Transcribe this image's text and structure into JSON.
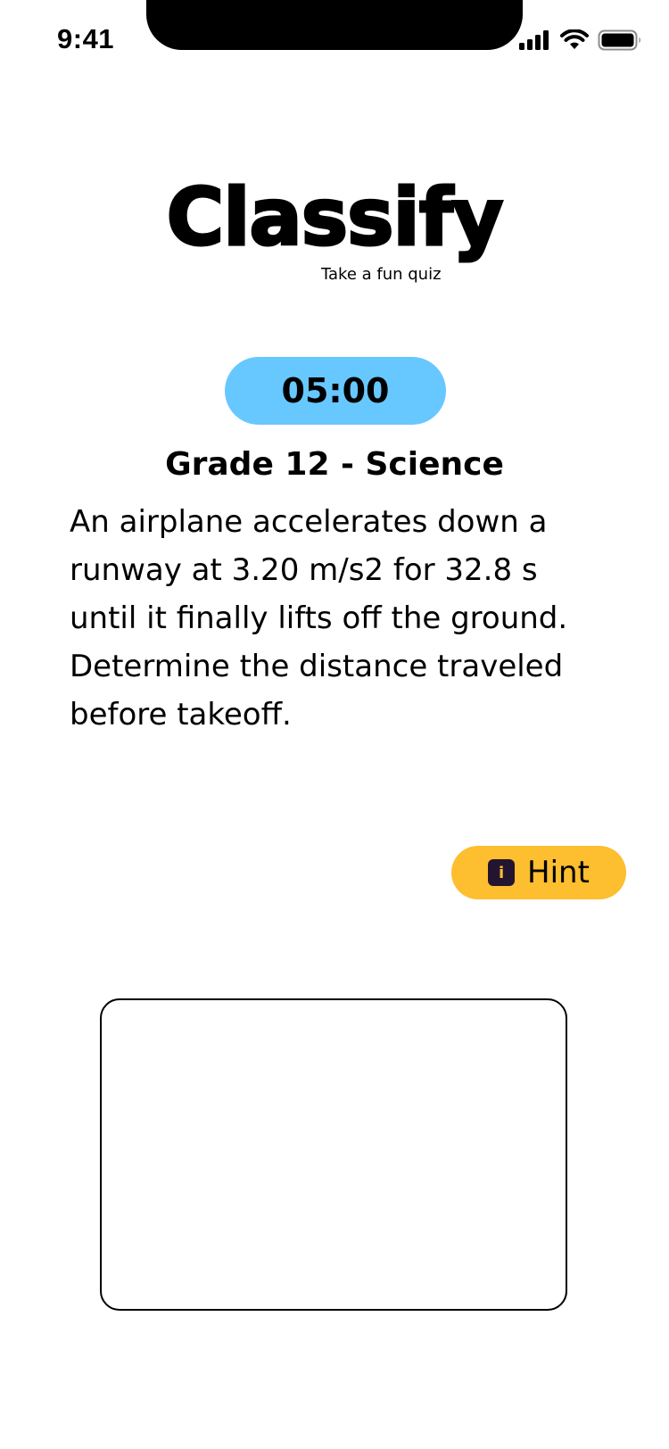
{
  "status_bar": {
    "time": "9:41",
    "icons": [
      "signal-icon",
      "wifi-icon",
      "battery-icon"
    ]
  },
  "logo": {
    "title": "Classify",
    "tagline": "Take a fun quiz"
  },
  "timer": {
    "value": "05:00",
    "color": "#66c8ff"
  },
  "quiz": {
    "subject": "Grade 12 - Science",
    "question": "An airplane accelerates down a runway at 3.20 m/s2 for 32.8 s until it finally lifts off the ground. Determine the distance traveled before takeoff."
  },
  "hint_button": {
    "label": "Hint",
    "icon_glyph": "i",
    "icon": "info-icon",
    "color": "#fdbe2f"
  },
  "answer": {
    "value": "",
    "placeholder": ""
  }
}
